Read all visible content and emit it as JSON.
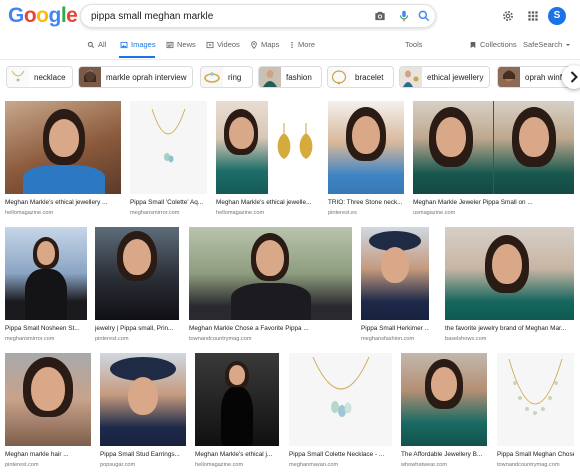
{
  "colors": {
    "accent": "#1a73e8",
    "text": "#202124",
    "muted": "#70757a"
  },
  "logo": {
    "letters": [
      "G",
      "o",
      "o",
      "g",
      "l",
      "e"
    ],
    "colors": [
      "#4285f4",
      "#ea4335",
      "#fbbc05",
      "#4285f4",
      "#34a853",
      "#ea4335"
    ]
  },
  "search": {
    "query": "pippa small meghan markle"
  },
  "user": {
    "initial": "S"
  },
  "tabs": [
    {
      "label": "All",
      "icon": "search-icon"
    },
    {
      "label": "Images",
      "icon": "image-icon",
      "active": true
    },
    {
      "label": "News",
      "icon": "news-icon"
    },
    {
      "label": "Videos",
      "icon": "video-icon"
    },
    {
      "label": "Maps",
      "icon": "map-pin-icon"
    },
    {
      "label": "More",
      "icon": "more-vert-icon"
    }
  ],
  "tools": {
    "tools": "Tools",
    "collections": "Collections",
    "safesearch": "SafeSearch"
  },
  "chips": [
    {
      "label": "necklace"
    },
    {
      "label": "markle oprah interview"
    },
    {
      "label": "ring"
    },
    {
      "label": "fashion"
    },
    {
      "label": "bracelet"
    },
    {
      "label": "ethical jewellery"
    },
    {
      "label": "oprah winf"
    }
  ],
  "results": [
    {
      "caption": "Meghan Markle's ethical jewellery ...",
      "source": "hellomagazine.com"
    },
    {
      "caption": "Pippa Small 'Colette' Aq...",
      "source": "meghansmirror.com"
    },
    {
      "caption": "Meghan Markle's ethical jewelle...",
      "source": "hellomagazine.com"
    },
    {
      "caption": "TRIO: Three Stone neck...",
      "source": "pinterest.es"
    },
    {
      "caption": "Meghan Markle Jeweler Pippa Small on ...",
      "source": "usmagazine.com"
    },
    {
      "caption": "Pippa Small Nosheen St...",
      "source": "meghansmirror.com"
    },
    {
      "caption": "jewelry | Pippa small, Prin...",
      "source": "pinterest.com"
    },
    {
      "caption": "Meghan Markle Chose a Favorite Pippa ...",
      "source": "townandcountrymag.com"
    },
    {
      "caption": "Pippa Small Herkimer ...",
      "source": "meghansfashion.com"
    },
    {
      "caption": "the favorite jewelry brand of Meghan Mar...",
      "source": "baselshows.com"
    },
    {
      "caption": "Meghan markle hair ...",
      "source": "pinterest.com"
    },
    {
      "caption": "Pippa Small Stud Earrings...",
      "source": "popsugar.com"
    },
    {
      "caption": "Meghan Markle's ethical j...",
      "source": "hellomagazine.com"
    },
    {
      "caption": "Pippa Small Colette Necklace - ...",
      "source": "meghanmavan.com"
    },
    {
      "caption": "The Affordable Jewellery B...",
      "source": "whowhatwear.com"
    },
    {
      "caption": "Pippa Small Meghan Chose ...",
      "source": "townandcountrymag.com"
    }
  ]
}
